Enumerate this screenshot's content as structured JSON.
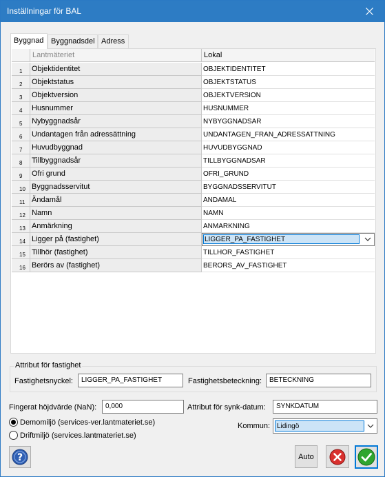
{
  "window": {
    "title": "Inställningar för BAL",
    "close_icon": "close-icon"
  },
  "tabs": [
    {
      "label": "Byggnad",
      "active": true
    },
    {
      "label": "Byggnadsdel",
      "active": false
    },
    {
      "label": "Adress",
      "active": false
    }
  ],
  "grid": {
    "columns": [
      "Lantmäteriet",
      "Lokal"
    ],
    "rows": [
      {
        "num": "1",
        "name": "Objektidentitet",
        "local": "OBJEKTIDENTITET"
      },
      {
        "num": "2",
        "name": "Objektstatus",
        "local": "OBJEKTSTATUS"
      },
      {
        "num": "3",
        "name": "Objektversion",
        "local": "OBJEKTVERSION"
      },
      {
        "num": "4",
        "name": "Husnummer",
        "local": "HUSNUMMER"
      },
      {
        "num": "5",
        "name": "Nybyggnadsår",
        "local": "NYBYGGNADSAR"
      },
      {
        "num": "6",
        "name": "Undantagen från adressättning",
        "local": "UNDANTAGEN_FRAN_ADRESSATTNING"
      },
      {
        "num": "7",
        "name": "Huvudbyggnad",
        "local": "HUVUDBYGGNAD"
      },
      {
        "num": "8",
        "name": "Tillbyggnadsår",
        "local": "TILLBYGGNADSAR"
      },
      {
        "num": "9",
        "name": "Ofri grund",
        "local": "OFRI_GRUND"
      },
      {
        "num": "10",
        "name": "Byggnadsservitut",
        "local": "BYGGNADSSERVITUT"
      },
      {
        "num": "11",
        "name": "Ändamål",
        "local": "ANDAMAL"
      },
      {
        "num": "12",
        "name": "Namn",
        "local": "NAMN"
      },
      {
        "num": "13",
        "name": "Anmärkning",
        "local": "ANMARKNING"
      },
      {
        "num": "14",
        "name": "Ligger på (fastighet)",
        "local": "LIGGER_PA_FASTIGHET",
        "editing": true
      },
      {
        "num": "15",
        "name": "Tillhör (fastighet)",
        "local": "TILLHOR_FASTIGHET"
      },
      {
        "num": "16",
        "name": "Berörs av (fastighet)",
        "local": "BERORS_AV_FASTIGHET"
      }
    ]
  },
  "fastighet": {
    "group_label": "Attribut för fastighet",
    "nyckel_label": "Fastighetsnyckel:",
    "nyckel_value": "LIGGER_PA_FASTIGHET",
    "beteckning_label": "Fastighetsbeteckning:",
    "beteckning_value": "BETECKNING"
  },
  "settings": {
    "hojd_label": "Fingerat höjdvärde (NaN):",
    "hojd_value": "0,000",
    "synk_label": "Attribut för synk-datum:",
    "synk_value": "SYNKDATUM",
    "env_demo_label": "Demomiljö (services-ver.lantmateriet.se)",
    "env_drift_label": "Driftmiljö (services.lantmateriet.se)",
    "env_selected": "demo",
    "kommun_label": "Kommun:",
    "kommun_value": "Lidingö"
  },
  "buttons": {
    "help_icon": "help-icon",
    "auto_label": "Auto",
    "cancel_icon": "cancel-icon",
    "ok_icon": "ok-checkmark-icon"
  },
  "colors": {
    "titlebar": "#2d7cc4",
    "selection": "#cce4f7",
    "selection_border": "#0078d7",
    "cancel": "#d9302e",
    "ok": "#2fa52f"
  }
}
